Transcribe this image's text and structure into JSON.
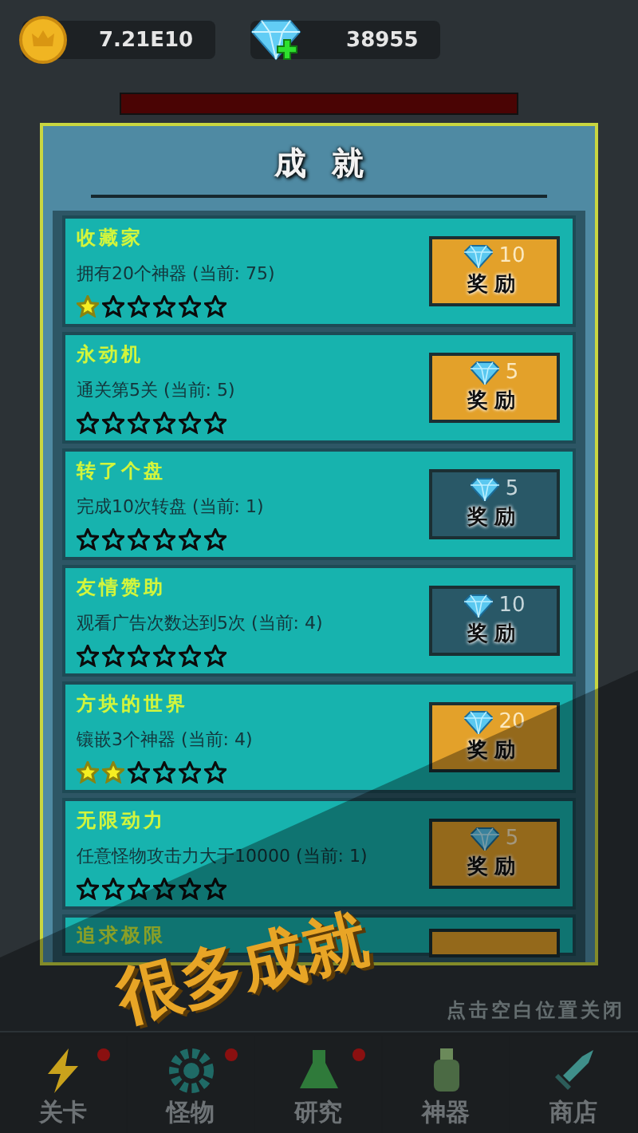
{
  "currency": {
    "coins": "7.21E10",
    "gems": "38955"
  },
  "dialog": {
    "title": "成就",
    "achievements": [
      {
        "title": "收藏家",
        "description": "拥有20个神器 (当前: 75)",
        "stars": 1,
        "reward": "10",
        "label": "奖励",
        "claimable": true
      },
      {
        "title": "永动机",
        "description": "通关第5关 (当前: 5)",
        "stars": 0,
        "reward": "5",
        "label": "奖励",
        "claimable": true
      },
      {
        "title": "转了个盘",
        "description": "完成10次转盘 (当前: 1)",
        "stars": 0,
        "reward": "5",
        "label": "奖励",
        "claimable": false
      },
      {
        "title": "友情赞助",
        "description": "观看广告次数达到5次 (当前: 4)",
        "stars": 0,
        "reward": "10",
        "label": "奖励",
        "claimable": false
      },
      {
        "title": "方块的世界",
        "description": "镶嵌3个神器 (当前: 4)",
        "stars": 2,
        "reward": "20",
        "label": "奖励",
        "claimable": true
      },
      {
        "title": "无限动力",
        "description": "任意怪物攻击力大于10000 (当前: 1)",
        "stars": 0,
        "reward": "5",
        "label": "奖励",
        "claimable": true
      },
      {
        "title": "追求极限"
      }
    ]
  },
  "hint": "点击空白位置关闭",
  "promo": "很多成就",
  "nav": [
    {
      "label": "关卡",
      "badge": true
    },
    {
      "label": "怪物",
      "badge": true
    },
    {
      "label": "研究",
      "badge": true
    },
    {
      "label": "神器",
      "badge": false
    },
    {
      "label": "商店",
      "badge": false
    }
  ]
}
